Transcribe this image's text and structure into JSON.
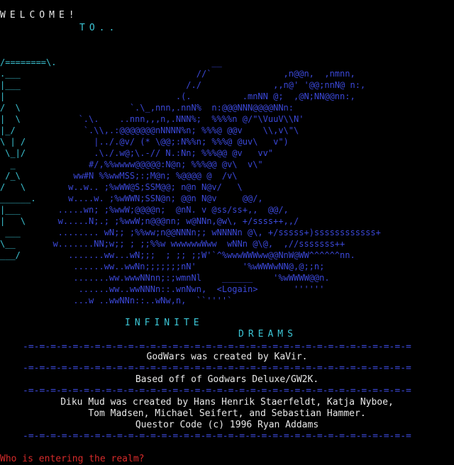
{
  "header": {
    "welcome": "WELCOME!",
    "to": "TO.."
  },
  "art": {
    "left_letters": [
      "/========\\.",
      ".___",
      "|___",
      "|   ",
      "/  \\",
      "|  \\",
      "|_/",
      "\\ | /",
      " \\_|/",
      "  _",
      " /_\\",
      "/   \\",
      "______.",
      "|___",
      "|   \\",
      " ___",
      "\\__",
      "___/"
    ],
    "dragon_lines": [
      "                                 __",
      "                              //`              ,n@@n,  ,nmnn,",
      "                            /./              ,,n@' '@@;nnN@ n:,",
      "                          .(.          .mnNN @;  ,@N;NN@@nn:,",
      "                 `.\\_,nnn,.nnN%  n:@@@NNN@@@@NNn:",
      "       `.\\.    ..nnn,,,n,.NNN%;  %%%%n @/\"\\VuuV\\\\N'",
      "        `.\\\\,.:@@@@@@@nNNNN%n; %%%@ @@v    \\\\,v\\\"\\",
      "          |../.@v/ (* \\@@;:N%%n; %%%@ @uv\\   v\")",
      "          .\\./.w@;\\.-// N.:Nn; %%%@@ @v   vv\"",
      "         #/,%%wwww@@@@@:N@n; %%%@@ @v\\  v\\\"",
      "      ww#N %%wwMSS;:;M@n; %@@@@ @  /v\\",
      "     w..w.. ;%wWW@S;SSM@@; n@n N@v/   \\",
      "     w....w. ;%wWWN;SSN@n; @@n N@v     @@/,",
      "   .....wn; ;%wwW;@@@@n;  @nN. v @ss/ss+,,  @@/,",
      "   w.....N;.; ;%wwW;n@@@nn; w@NNn,@w\\, +/ssss++,,/",
      "   ........ wN;; ;%%ww;n@@NNNn;; wNNNNn @\\, +/sssss+)ssssssssssss+",
      "  w.......NN;w;; ; ;;%%w wwwwwwWww  wNNn @\\@,  ,//sssssss++",
      "     .......ww...wN;;;  ; ;; ;;W'`^%wwwWWWww@@NnW@WW^^^^^^nn.",
      "      ......ww..wwNn;;;;;;;nN'         '%wWWWwNN@,@;;n;",
      "      .......ww.wwwNNnn;:;wmnNl    ______    '%wWWWW@@n.",
      "       ......ww..wwNNNn::.wnNwn,  <Logain>       ''''''",
      "      ...w ..wwNNn::..wNw,n,  ``''''`"
    ]
  },
  "title": {
    "line1": "INFINITE",
    "line2": "DREAMS"
  },
  "divider": "-=-=-=-=-=-=-=-=-=-=-=-=-=-=-=-=-=-=-=-=-=-=-=-=-=-=-=-=-=-=-=-=-=-=-=",
  "credits": {
    "line1": "GodWars was created by KaVir.",
    "line2": "Based off of Godwars Deluxe/GW2K.",
    "line3": "Diku Mud was created by Hans Henrik Staerfeldt, Katja Nyboe,",
    "line4": "Tom Madsen, Michael Seifert, and Sebastian Hammer.",
    "line5": "Questor Code (c) 1996 Ryan Addams"
  },
  "prompt": {
    "text": "Who is entering the realm?"
  },
  "colors": {
    "cyan": "#3cc6d6",
    "blue": "#3b48d8",
    "white": "#e8e8e8",
    "red": "#d52a2a"
  }
}
